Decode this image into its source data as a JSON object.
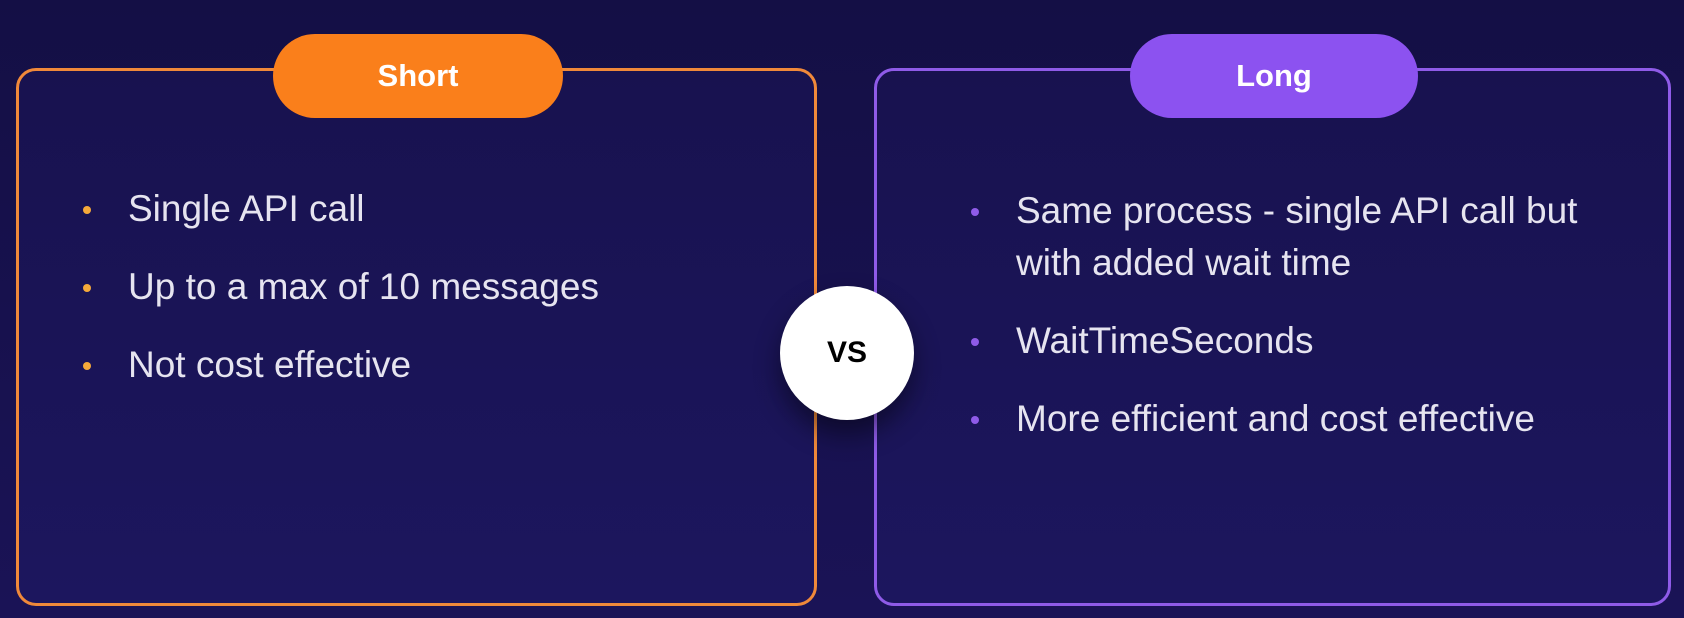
{
  "left_card": {
    "title": "Short",
    "items": [
      "Single API call",
      "Up to a max of 10 messages",
      "Not cost effective"
    ]
  },
  "right_card": {
    "title": "Long",
    "items": [
      "Same process - single API call but with added wait time",
      "WaitTimeSeconds",
      "More efficient and cost effective"
    ]
  },
  "vs_label": "VS",
  "colors": {
    "background": "#140f45",
    "short_accent": "#fa7f1b",
    "long_accent": "#8c52f0",
    "text": "#e6e4f0"
  }
}
